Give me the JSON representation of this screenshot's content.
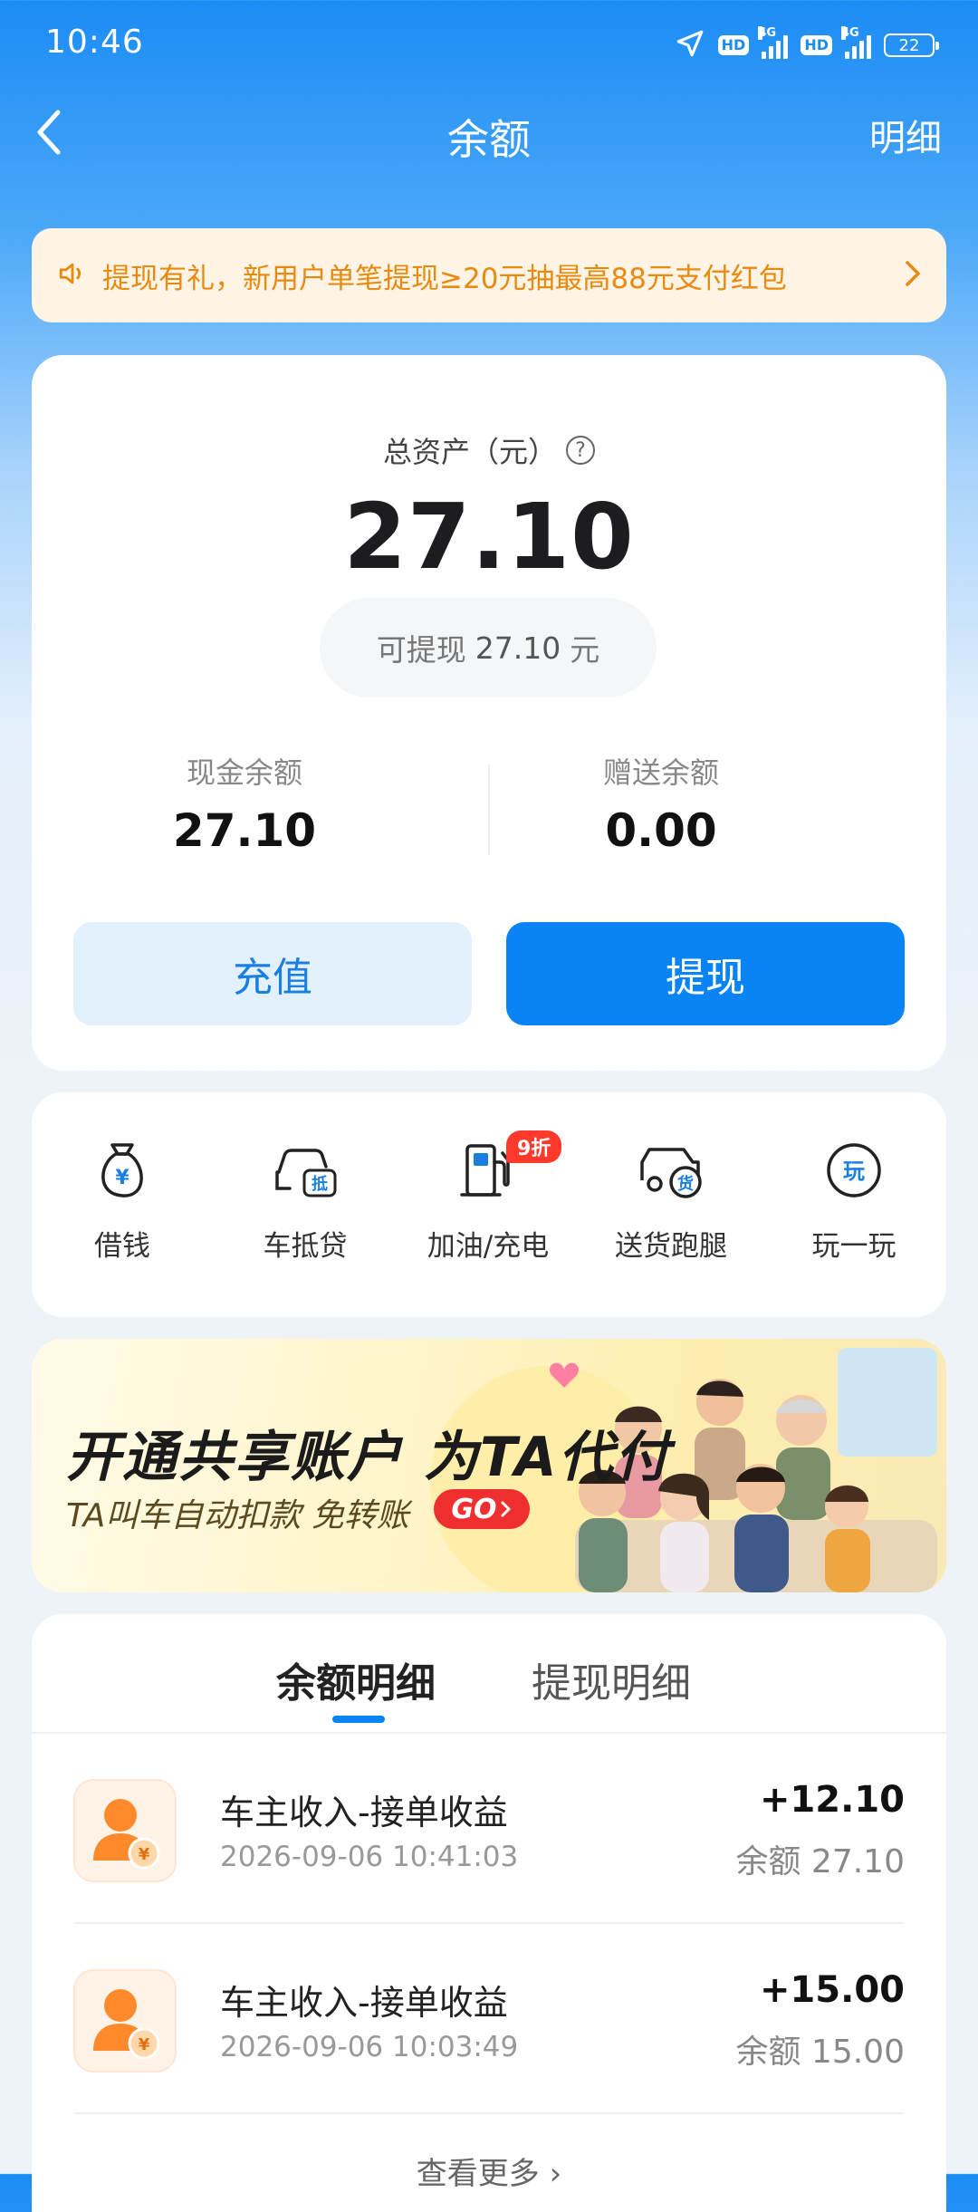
{
  "status_bar": {
    "time": "10:46",
    "hd_1": "HD",
    "net_1": "4G",
    "hd_2": "HD",
    "net_2": "4G",
    "battery": "22"
  },
  "nav": {
    "title": "余额",
    "detail_link": "明细"
  },
  "notice": {
    "text": "提现有礼，新用户单笔提现≥20元抽最高88元支付红包"
  },
  "balance": {
    "total_label": "总资产（元）",
    "help_glyph": "?",
    "total": "27.10",
    "withdrawable_prefix": "可提现",
    "withdrawable_amount": "27.10",
    "withdrawable_unit": "元",
    "cash_label": "现金余额",
    "cash_value": "27.10",
    "gift_label": "赠送余额",
    "gift_value": "0.00",
    "recharge_label": "充值",
    "withdraw_label": "提现"
  },
  "services": [
    {
      "label": "借钱",
      "icon": "money-bag-icon",
      "glyph": "¥"
    },
    {
      "label": "车抵贷",
      "icon": "car-loan-icon",
      "glyph": "抵"
    },
    {
      "label": "加油/充电",
      "icon": "fuel-pump-icon",
      "badge": "9折"
    },
    {
      "label": "送货跑腿",
      "icon": "delivery-van-icon",
      "glyph": "货"
    },
    {
      "label": "玩一玩",
      "icon": "play-icon",
      "glyph": "玩"
    }
  ],
  "banner": {
    "title": "开通共享账户 为TA代付",
    "subtitle": "TA叫车自动扣款 免转账",
    "cta": "GO"
  },
  "records": {
    "tab_balance": "余额明细",
    "tab_withdraw": "提现明细",
    "items": [
      {
        "title": "车主收入-接单收益",
        "time": "2026-09-06 10:41:03",
        "amount": "+12.10",
        "balance_after": "余额 27.10"
      },
      {
        "title": "车主收入-接单收益",
        "time": "2026-09-06 10:03:49",
        "amount": "+15.00",
        "balance_after": "余额 15.00"
      }
    ],
    "view_more": "查看更多 ›"
  },
  "colors": {
    "primary_blue": "#0a84f5",
    "notice_orange": "#e88a0e",
    "badge_red": "#ff3a2c"
  }
}
